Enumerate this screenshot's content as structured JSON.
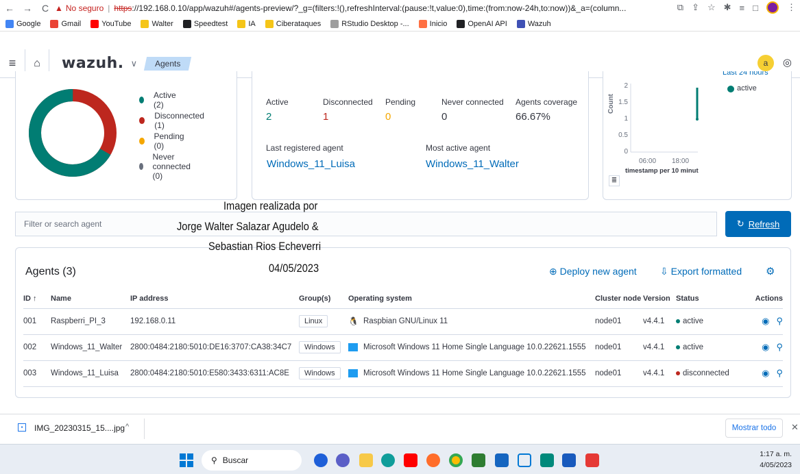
{
  "browser": {
    "insecure_label": "No seguro",
    "url_scheme": "https",
    "url_rest": "://192.168.0.10/app/wazuh#/agents-preview/?_g=(filters:!(),refreshInterval:(pause:!t,value:0),time:(from:now-24h,to:now))&_a=(column...",
    "bookmarks": [
      {
        "label": "Google",
        "color": "#4285f4"
      },
      {
        "label": "Gmail",
        "color": "#ea4335"
      },
      {
        "label": "YouTube",
        "color": "#ff0000"
      },
      {
        "label": "Walter",
        "color": "#f5c518"
      },
      {
        "label": "Speedtest",
        "color": "#202124"
      },
      {
        "label": "IA",
        "color": "#f5c518"
      },
      {
        "label": "Ciberataques",
        "color": "#f5c518"
      },
      {
        "label": "RStudio Desktop -...",
        "color": "#9e9e9e"
      },
      {
        "label": "Inicio",
        "color": "#ff7043"
      },
      {
        "label": "OpenAI API",
        "color": "#202124"
      },
      {
        "label": "Wazuh",
        "color": "#3f51b5"
      }
    ]
  },
  "header": {
    "logo": "wazuh.",
    "breadcrumb": "Agents",
    "avatar_letter": "a"
  },
  "status_legend": [
    {
      "label": "Active (2)",
      "color": "#017d73"
    },
    {
      "label": "Disconnected (1)",
      "color": "#bd271e"
    },
    {
      "label": "Pending (0)",
      "color": "#f5a700"
    },
    {
      "label": "Never connected (0)",
      "color": "#69707d"
    }
  ],
  "donut": {
    "active": 2,
    "disconnected": 1,
    "pending": 0,
    "never_connected": 0
  },
  "details": {
    "stats": [
      {
        "label": "Active",
        "value": "2",
        "color": "#017d73"
      },
      {
        "label": "Disconnected",
        "value": "1",
        "color": "#bd271e"
      },
      {
        "label": "Pending",
        "value": "0",
        "color": "#f5a700"
      },
      {
        "label": "Never connected",
        "value": "0",
        "color": "#343741"
      },
      {
        "label": "Agents coverage",
        "value": "66.67%",
        "color": "#343741"
      }
    ],
    "last_registered_label": "Last registered agent",
    "last_registered_value": "Windows_11_Luisa",
    "most_active_label": "Most active agent",
    "most_active_value": "Windows_11_Walter"
  },
  "evolution": {
    "top_label": "Last 24 hours",
    "legend_label": "active",
    "y_label": "Count",
    "x_label": "timestamp per 10 minut",
    "y_ticks": [
      "2",
      "1.5",
      "1",
      "0.5",
      "0"
    ],
    "x_ticks": [
      "06:00",
      "18:00"
    ]
  },
  "filter": {
    "placeholder": "Filter or search agent"
  },
  "refresh_label": "Refresh",
  "overlay_text": [
    "Imagen realizada por",
    "Jorge Walter Salazar Agudelo &",
    "Sebastian Rios Echeverri",
    "04/05/2023"
  ],
  "agents": {
    "title": "Agents (3)",
    "deploy_label": "Deploy new agent",
    "export_label": "Export formatted",
    "columns": [
      "ID ↑",
      "Name",
      "IP address",
      "Group(s)",
      "Operating system",
      "Cluster node",
      "Version",
      "Status",
      "Actions"
    ],
    "rows": [
      {
        "id": "001",
        "name": "Raspberri_PI_3",
        "ip": "192.168.0.11",
        "group": "Linux",
        "os": "Raspbian GNU/Linux 11",
        "os_icon": "linux-icon",
        "node": "node01",
        "version": "v4.4.1",
        "status": "active",
        "status_color": "#017d73"
      },
      {
        "id": "002",
        "name": "Windows_11_Walter",
        "ip": "2800:0484:2180:5010:DE16:3707:CA38:34C7",
        "group": "Windows",
        "os": "Microsoft Windows 11 Home Single Language 10.0.22621.1555",
        "os_icon": "windows-icon",
        "node": "node01",
        "version": "v4.4.1",
        "status": "active",
        "status_color": "#017d73"
      },
      {
        "id": "003",
        "name": "Windows_11_Luisa",
        "ip": "2800:0484:2180:5010:E580:3433:6311:AC8E",
        "group": "Windows",
        "os": "Microsoft Windows 11 Home Single Language 10.0.22621.1555",
        "os_icon": "windows-icon",
        "node": "node01",
        "version": "v4.4.1",
        "status": "disconnected",
        "status_color": "#bd271e"
      }
    ]
  },
  "download": {
    "file": "IMG_20230315_15....jpg",
    "show_all": "Mostrar todo"
  },
  "taskbar": {
    "search": "Buscar",
    "time": "1:17 a. m.",
    "date": "4/05/2023"
  }
}
